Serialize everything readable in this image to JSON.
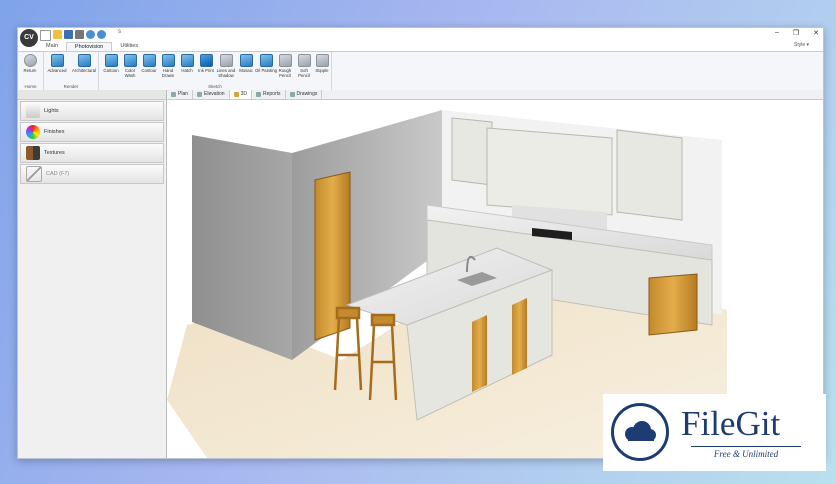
{
  "app": {
    "logo_text": "CV",
    "window_title": "s",
    "controls": {
      "minimize": "–",
      "maximize": "❐",
      "close": "✕"
    }
  },
  "ribbon_tabs": [
    {
      "label": "Main"
    },
    {
      "label": "Photovision"
    },
    {
      "label": "Utilities"
    }
  ],
  "style_label": "Style ▾",
  "ribbon": {
    "home": {
      "label": "Home",
      "buttons": [
        {
          "label": "Return"
        }
      ]
    },
    "render": {
      "label": "Render",
      "buttons": [
        {
          "label": "Advanced"
        },
        {
          "label": "Architectural"
        }
      ]
    },
    "sketch": {
      "label": "Sketch",
      "buttons": [
        {
          "label": "Cartoon"
        },
        {
          "label": "Color Wash"
        },
        {
          "label": "Contour"
        },
        {
          "label": "Hand Drawn"
        },
        {
          "label": "Hatch"
        },
        {
          "label": "Ink Print"
        },
        {
          "label": "Lines and Shadow"
        },
        {
          "label": "Mosaic"
        },
        {
          "label": "Oil Painting"
        },
        {
          "label": "Rough Pencil"
        },
        {
          "label": "Soft Pencil"
        },
        {
          "label": "Stipple"
        }
      ]
    }
  },
  "left_panel": {
    "items": [
      {
        "label": "Lights"
      },
      {
        "label": "Finishes"
      },
      {
        "label": "Textures"
      },
      {
        "label": "CAD (F7)"
      }
    ]
  },
  "view_tabs": [
    {
      "label": "Plan"
    },
    {
      "label": "Elevation"
    },
    {
      "label": "3D"
    },
    {
      "label": "Reports"
    },
    {
      "label": "Drawings"
    }
  ],
  "watermark": {
    "name": "FileGit",
    "tagline": "Free & Unlimited"
  },
  "colors": {
    "accent": "#2a7bc1",
    "brand": "#1d3c73"
  }
}
